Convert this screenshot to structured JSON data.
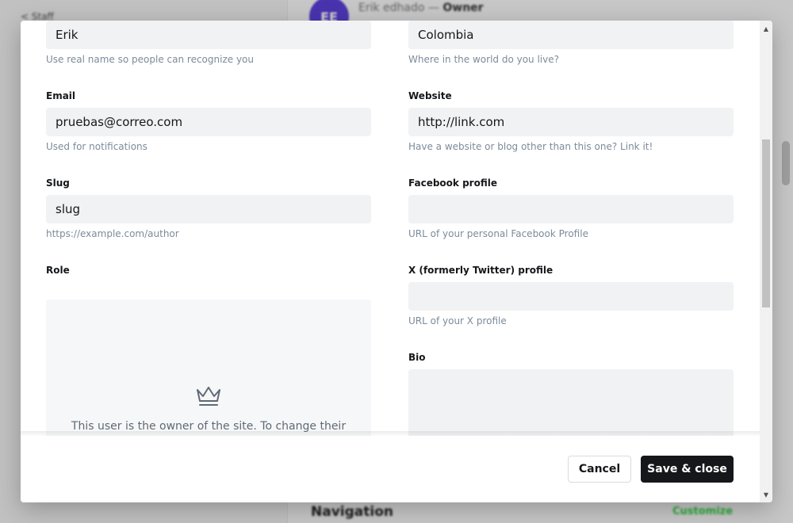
{
  "background": {
    "back_label": "< Staff",
    "avatar_initials": "EE",
    "owner_name": "Erik edhado",
    "owner_separator": " — ",
    "owner_role": "Owner",
    "nav_title": "Navigation",
    "customize_label": "Customize"
  },
  "form": {
    "left": {
      "name": {
        "value": "Erik",
        "hint": "Use real name so people can recognize you"
      },
      "email": {
        "label": "Email",
        "value": "pruebas@correo.com",
        "hint": "Used for notifications"
      },
      "slug": {
        "label": "Slug",
        "value": "slug",
        "hint": "https://example.com/author"
      },
      "role": {
        "label": "Role",
        "owner_text": "This user is the owner of the site. To change their",
        "icon": "crown-icon"
      }
    },
    "right": {
      "location": {
        "value": "Colombia",
        "hint": "Where in the world do you live?"
      },
      "website": {
        "label": "Website",
        "value": "http://link.com",
        "hint": "Have a website or blog other than this one? Link it!"
      },
      "facebook": {
        "label": "Facebook profile",
        "value": "",
        "hint": "URL of your personal Facebook Profile"
      },
      "x_profile": {
        "label": "X (formerly Twitter) profile",
        "value": "",
        "hint": "URL of your X profile"
      },
      "bio": {
        "label": "Bio",
        "value": ""
      }
    }
  },
  "footer": {
    "cancel_label": "Cancel",
    "save_label": "Save & close"
  },
  "colors": {
    "primary_button": "#15171a",
    "accent_green": "#30cf43",
    "avatar_purple": "#5b3fd6",
    "input_background": "#f1f2f3"
  }
}
